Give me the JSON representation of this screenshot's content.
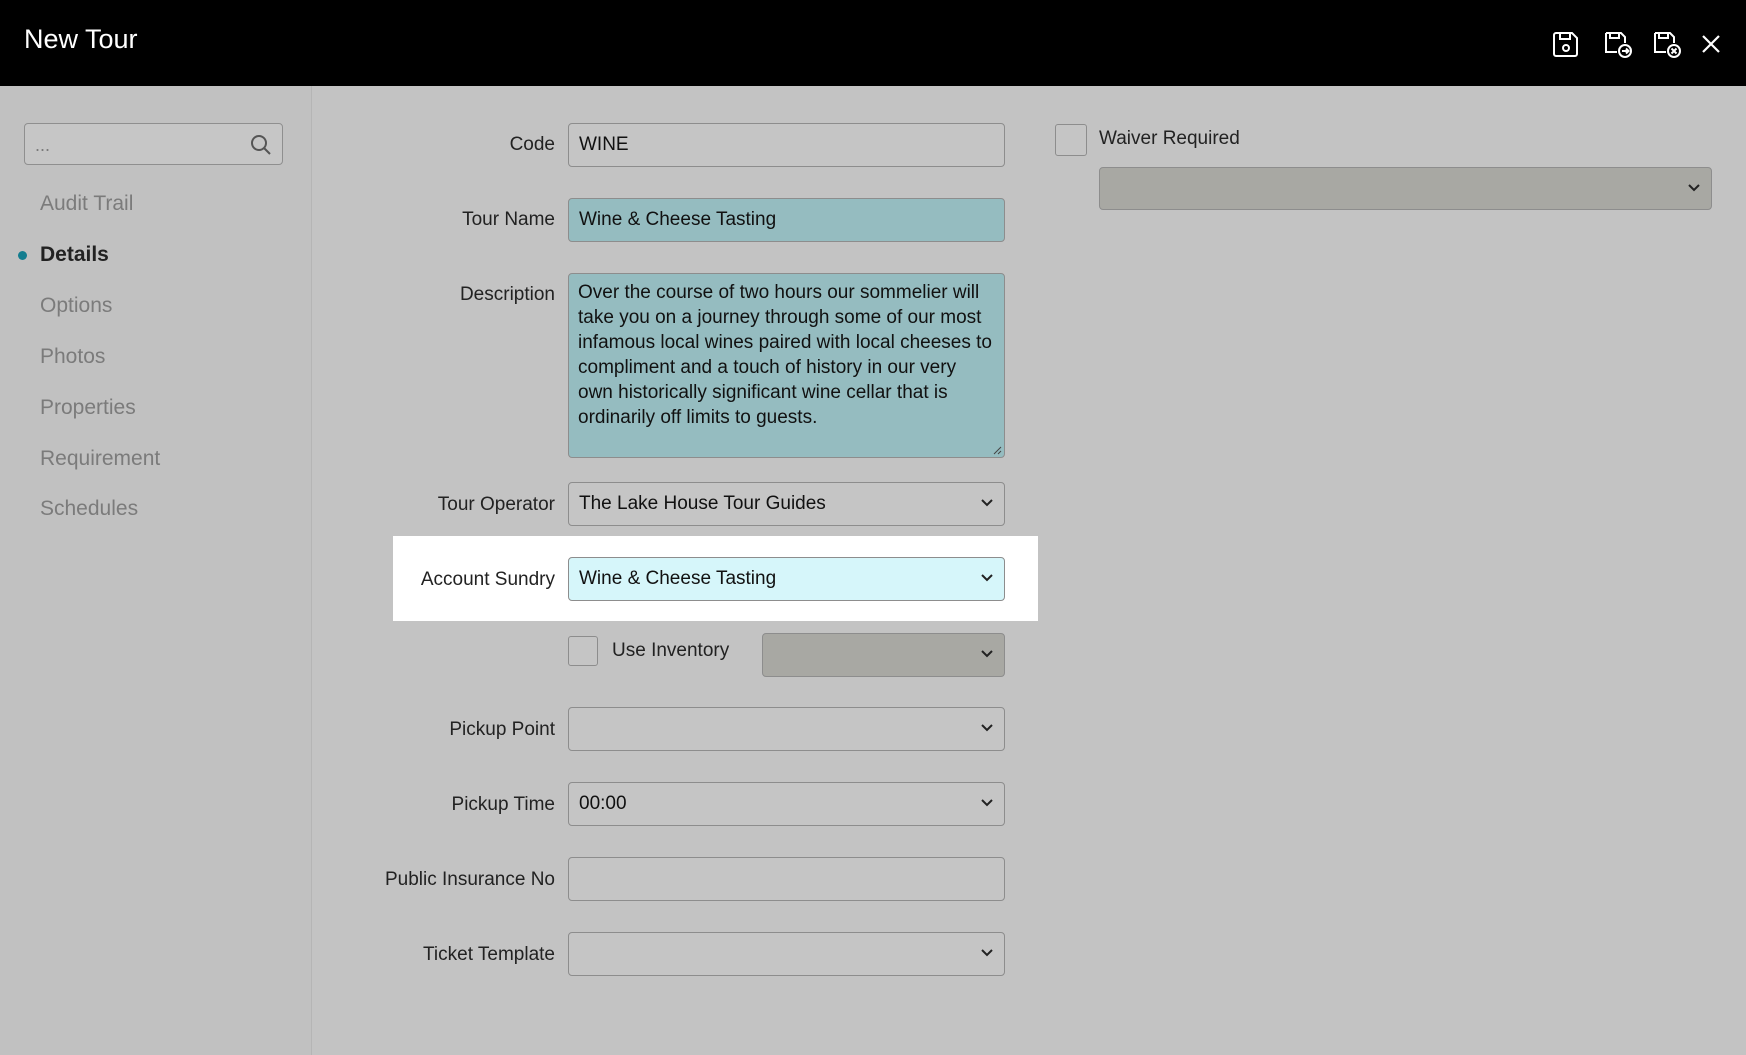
{
  "window": {
    "title": "New Tour"
  },
  "toolbar": {
    "icons": [
      "save-icon",
      "save-and-new-icon",
      "save-and-close-icon",
      "close-icon"
    ]
  },
  "sidebar": {
    "search": {
      "placeholder": "..."
    },
    "items": [
      {
        "label": "Audit Trail",
        "active": false
      },
      {
        "label": "Details",
        "active": true
      },
      {
        "label": "Options",
        "active": false
      },
      {
        "label": "Photos",
        "active": false
      },
      {
        "label": "Properties",
        "active": false
      },
      {
        "label": "Requirement",
        "active": false
      },
      {
        "label": "Schedules",
        "active": false
      }
    ]
  },
  "form": {
    "code": {
      "label": "Code",
      "value": "WINE"
    },
    "tour_name": {
      "label": "Tour Name",
      "value": "Wine & Cheese Tasting"
    },
    "description": {
      "label": "Description",
      "value": "Over the course of two hours our sommelier will take you on a journey through some of our most infamous local wines paired with local cheeses to compliment and a touch of history in our very own historically significant wine cellar that is ordinarily off limits to guests."
    },
    "tour_operator": {
      "label": "Tour Operator",
      "value": "The Lake House Tour Guides"
    },
    "account_sundry": {
      "label": "Account Sundry",
      "value": "Wine & Cheese Tasting"
    },
    "use_inventory": {
      "label": "Use Inventory",
      "checked": false,
      "select_value": ""
    },
    "pickup_point": {
      "label": "Pickup Point",
      "value": ""
    },
    "pickup_time": {
      "label": "Pickup Time",
      "value": "00:00"
    },
    "public_insurance_no": {
      "label": "Public Insurance No",
      "value": ""
    },
    "ticket_template": {
      "label": "Ticket Template",
      "value": ""
    },
    "waiver_required": {
      "label": "Waiver Required",
      "checked": false,
      "select_value": ""
    }
  },
  "colors": {
    "topbar": "#000000",
    "accent": "#137d8f",
    "teal_field": "#95bcc0",
    "focused_field": "#d6f6fa"
  }
}
